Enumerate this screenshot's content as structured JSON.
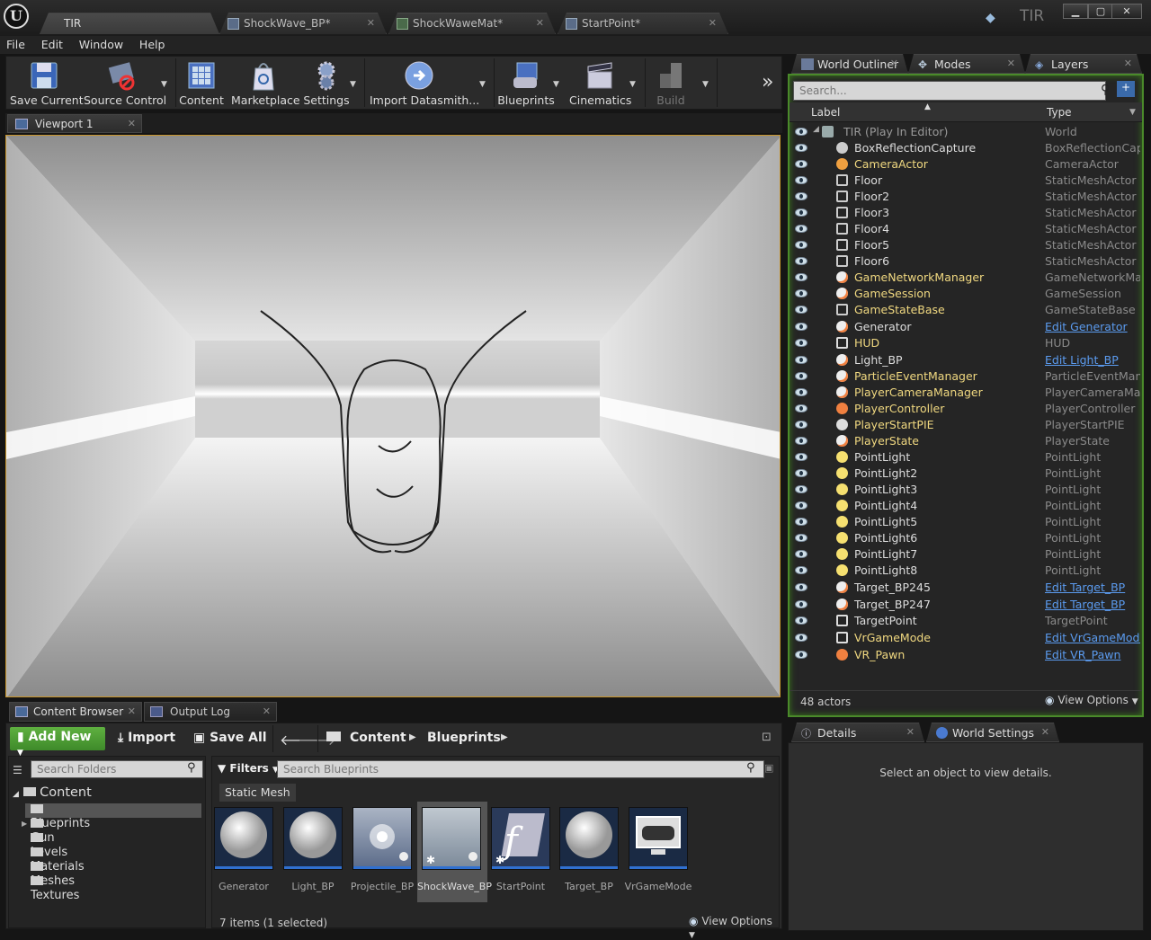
{
  "title_bar": {
    "logo": "ue-logo",
    "tabs": [
      "TIR",
      "ShockWave_BP*",
      "ShockWaweMat*",
      "StartPoint*"
    ],
    "project_name": "TIR",
    "window_buttons": [
      "minimize",
      "maximize",
      "close"
    ]
  },
  "menu": [
    "File",
    "Edit",
    "Window",
    "Help"
  ],
  "toolbar": {
    "buttons": [
      "Save Current",
      "Source Control",
      "Content",
      "Marketplace",
      "Settings",
      "Import Datasmith...",
      "Blueprints",
      "Cinematics",
      "Build"
    ],
    "overflow": "»"
  },
  "viewport": {
    "tab": "Viewport 1"
  },
  "right_tabs": [
    "World Outliner",
    "Modes",
    "Layers"
  ],
  "outliner": {
    "search_placeholder": "Search...",
    "col_label": "Label",
    "col_type": "Type",
    "actor_count": "48 actors",
    "view_options": "View Options",
    "rows": [
      {
        "label": "TIR (Play In Editor)",
        "type": "World",
        "color": "grey",
        "icon": "world-icon"
      },
      {
        "label": "BoxReflectionCapture",
        "type": "BoxReflectionCaptu",
        "color": "white",
        "icon": "reflection-capture-icon"
      },
      {
        "label": "CameraActor",
        "type": "CameraActor",
        "color": "yellow",
        "icon": "camera-icon"
      },
      {
        "label": "Floor",
        "type": "StaticMeshActor",
        "color": "white",
        "icon": "static-mesh-icon"
      },
      {
        "label": "Floor2",
        "type": "StaticMeshActor",
        "color": "white",
        "icon": "static-mesh-icon"
      },
      {
        "label": "Floor3",
        "type": "StaticMeshActor",
        "color": "white",
        "icon": "static-mesh-icon"
      },
      {
        "label": "Floor4",
        "type": "StaticMeshActor",
        "color": "white",
        "icon": "static-mesh-icon"
      },
      {
        "label": "Floor5",
        "type": "StaticMeshActor",
        "color": "white",
        "icon": "static-mesh-icon"
      },
      {
        "label": "Floor6",
        "type": "StaticMeshActor",
        "color": "white",
        "icon": "static-mesh-icon"
      },
      {
        "label": "GameNetworkManager",
        "type": "GameNetworkMana",
        "color": "yellow",
        "icon": "actor-icon"
      },
      {
        "label": "GameSession",
        "type": "GameSession",
        "color": "yellow",
        "icon": "actor-icon"
      },
      {
        "label": "GameStateBase",
        "type": "GameStateBase",
        "color": "yellow",
        "icon": "game-state-icon"
      },
      {
        "label": "Generator",
        "type": "Edit Generator",
        "color": "white",
        "icon": "actor-icon",
        "link": true
      },
      {
        "label": "HUD",
        "type": "HUD",
        "color": "yellow",
        "icon": "hud-icon"
      },
      {
        "label": "Light_BP",
        "type": "Edit Light_BP",
        "color": "white",
        "icon": "actor-icon",
        "link": true
      },
      {
        "label": "ParticleEventManager",
        "type": "ParticleEventManag",
        "color": "yellow",
        "icon": "actor-icon"
      },
      {
        "label": "PlayerCameraManager",
        "type": "PlayerCameraMana",
        "color": "yellow",
        "icon": "actor-icon"
      },
      {
        "label": "PlayerController",
        "type": "PlayerController",
        "color": "yellow",
        "icon": "player-controller-icon"
      },
      {
        "label": "PlayerStartPIE",
        "type": "PlayerStartPIE",
        "color": "yellow",
        "icon": "player-start-icon"
      },
      {
        "label": "PlayerState",
        "type": "PlayerState",
        "color": "yellow",
        "icon": "actor-icon"
      },
      {
        "label": "PointLight",
        "type": "PointLight",
        "color": "white",
        "icon": "point-light-icon"
      },
      {
        "label": "PointLight2",
        "type": "PointLight",
        "color": "white",
        "icon": "point-light-icon"
      },
      {
        "label": "PointLight3",
        "type": "PointLight",
        "color": "white",
        "icon": "point-light-icon"
      },
      {
        "label": "PointLight4",
        "type": "PointLight",
        "color": "white",
        "icon": "point-light-icon"
      },
      {
        "label": "PointLight5",
        "type": "PointLight",
        "color": "white",
        "icon": "point-light-icon"
      },
      {
        "label": "PointLight6",
        "type": "PointLight",
        "color": "white",
        "icon": "point-light-icon"
      },
      {
        "label": "PointLight7",
        "type": "PointLight",
        "color": "white",
        "icon": "point-light-icon"
      },
      {
        "label": "PointLight8",
        "type": "PointLight",
        "color": "white",
        "icon": "point-light-icon"
      },
      {
        "label": "Target_BP245",
        "type": "Edit Target_BP",
        "color": "white",
        "icon": "actor-icon",
        "link": true
      },
      {
        "label": "Target_BP247",
        "type": "Edit Target_BP",
        "color": "white",
        "icon": "actor-icon",
        "link": true
      },
      {
        "label": "TargetPoint",
        "type": "TargetPoint",
        "color": "white",
        "icon": "target-point-icon"
      },
      {
        "label": "VrGameMode",
        "type": "Edit VrGameMode",
        "color": "yellow",
        "icon": "game-mode-icon",
        "link": true
      },
      {
        "label": "VR_Pawn",
        "type": "Edit VR_Pawn",
        "color": "yellow",
        "icon": "pawn-icon",
        "link": true
      }
    ]
  },
  "details": {
    "tabs": [
      "Details",
      "World Settings"
    ],
    "empty_message": "Select an object to view details."
  },
  "bottom_tabs": [
    "Content Browser",
    "Output Log"
  ],
  "content_browser": {
    "add_new": "Add New",
    "import": "Import",
    "save_all": "Save All",
    "path": [
      "Content",
      "Blueprints"
    ],
    "search_folders_placeholder": "Search Folders",
    "filters": "Filters",
    "search_placeholder": "Search Blueprints",
    "active_filter": "Static Mesh",
    "tree_root": "Content",
    "folders": [
      "Blueprints",
      "Gun",
      "Levels",
      "Materials",
      "Meshes",
      "Textures"
    ],
    "assets": [
      "Generator",
      "Light_BP",
      "Projectile_BP",
      "ShockWave_BP",
      "StartPoint",
      "Target_BP",
      "VrGameMode"
    ],
    "selected_asset": "ShockWave_BP",
    "status": "7 items (1 selected)",
    "view_options": "View Options"
  },
  "colors": {
    "outliner_border": "#4a8a2a",
    "viewport_border": "#c8952a",
    "link": "#5b9bef",
    "actor_yellow": "#f0d880",
    "add_new_green": "#4a9c34"
  }
}
